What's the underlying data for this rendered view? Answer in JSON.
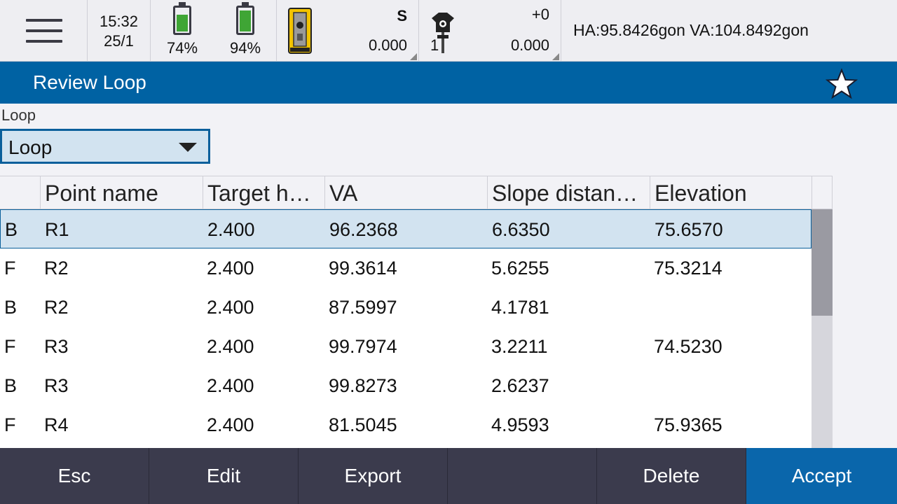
{
  "status": {
    "time": "15:32",
    "date": "25/1",
    "battery1": {
      "percent_label": "74%",
      "level": 0.74
    },
    "battery2": {
      "percent_label": "94%",
      "level": 0.94
    },
    "instrument": {
      "mode": "S",
      "value": "0.000"
    },
    "target": {
      "number": "1",
      "offset": "+0",
      "value": "0.000"
    },
    "angles": "HA:95.8426gon  VA:104.8492gon"
  },
  "titlebar": {
    "title": "Review Loop"
  },
  "loop": {
    "label": "Loop",
    "selected": "Loop"
  },
  "table": {
    "columns": [
      "",
      "Point name",
      "Target h…",
      "VA",
      "Slope distan…",
      "Elevation"
    ],
    "rows": [
      {
        "face": "B",
        "point": "R1",
        "target_h": "2.400",
        "va": "96.2368",
        "slope": "6.6350",
        "elev": "75.6570"
      },
      {
        "face": "F",
        "point": "R2",
        "target_h": "2.400",
        "va": "99.3614",
        "slope": "5.6255",
        "elev": "75.3214"
      },
      {
        "face": "B",
        "point": "R2",
        "target_h": "2.400",
        "va": "87.5997",
        "slope": "4.1781",
        "elev": ""
      },
      {
        "face": "F",
        "point": "R3",
        "target_h": "2.400",
        "va": "99.7974",
        "slope": "3.2211",
        "elev": "74.5230"
      },
      {
        "face": "B",
        "point": "R3",
        "target_h": "2.400",
        "va": "99.8273",
        "slope": "2.6237",
        "elev": ""
      },
      {
        "face": "F",
        "point": "R4",
        "target_h": "2.400",
        "va": "81.5045",
        "slope": "4.9593",
        "elev": "75.9365"
      }
    ],
    "selected_row": 0
  },
  "footer": {
    "esc": "Esc",
    "edit": "Edit",
    "export": "Export",
    "empty": "",
    "delete": "Delete",
    "accept": "Accept"
  },
  "colors": {
    "title_bar": "#0062a3",
    "accent_button": "#0a66ab",
    "footer_bg": "#3b3b4d",
    "selection": "#d2e3f0",
    "battery": "#3fa535"
  },
  "icons": [
    "menu-icon",
    "battery-icon",
    "total-station-icon",
    "prism-target-icon",
    "star-icon",
    "dropdown-arrow-icon"
  ]
}
